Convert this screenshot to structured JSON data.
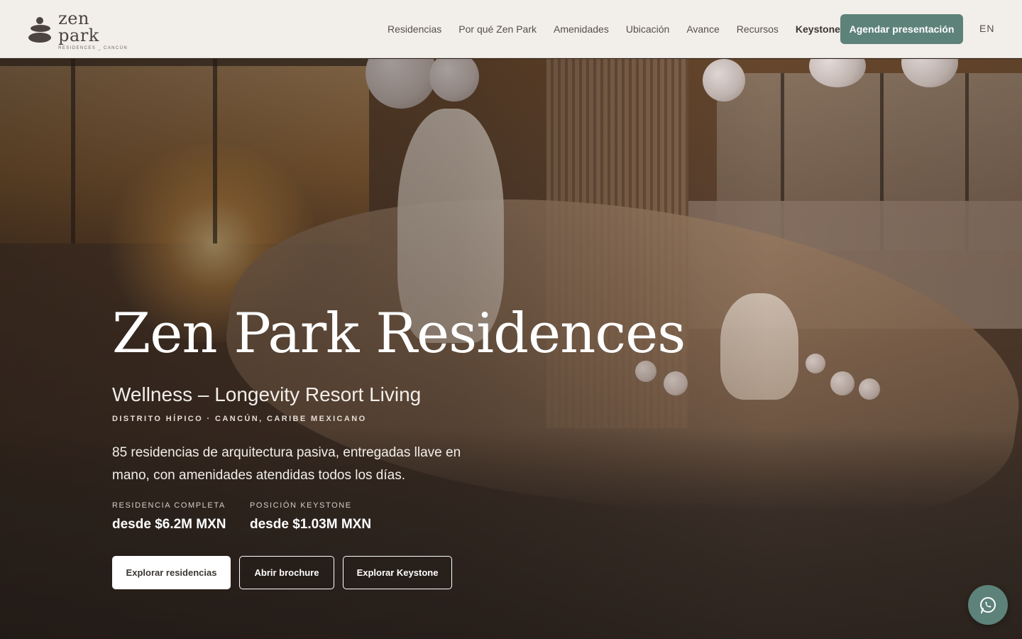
{
  "header": {
    "logo": {
      "name": "zen park",
      "sub": "RESIDENCES _ CANCÚN"
    },
    "nav": [
      {
        "label": "Residencias"
      },
      {
        "label": "Por qué Zen Park"
      },
      {
        "label": "Amenidades"
      },
      {
        "label": "Ubicación"
      },
      {
        "label": "Avance"
      },
      {
        "label": "Recursos"
      },
      {
        "label": "Keystone"
      }
    ],
    "cta_label": "Agendar presentación",
    "lang_label": "EN"
  },
  "hero": {
    "title": "Zen Park Residences",
    "subtitle": "Wellness – Longevity Resort Living",
    "location": "DISTRITO HÍPICO · CANCÚN, CARIBE MEXICANO",
    "description": "85 residencias de arquitectura pasiva, entregadas llave en mano, con amenidades atendidas todos los días.",
    "prices": [
      {
        "label": "RESIDENCIA COMPLETA",
        "value": "desde $6.2M MXN"
      },
      {
        "label": "POSICIÓN KEYSTONE",
        "value": "desde $1.03M MXN"
      }
    ],
    "buttons": {
      "explore": "Explorar residencias",
      "brochure": "Abrir brochure",
      "keystone": "Explorar Keystone"
    }
  },
  "floating": {
    "icon": "whatsapp-icon"
  },
  "colors": {
    "accent": "#5d8279",
    "header_bg": "#f2eeea",
    "nav_text": "#55504c",
    "hero_text": "#ffffff"
  }
}
